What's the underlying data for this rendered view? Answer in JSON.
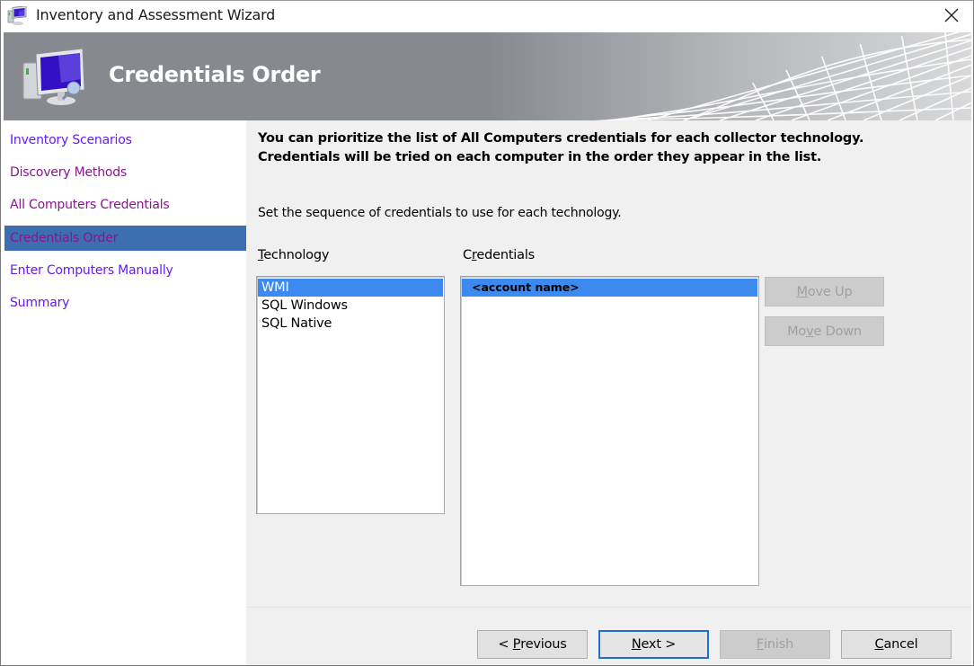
{
  "window": {
    "title": "Inventory and Assessment Wizard",
    "app_icon": "computer-icon",
    "close_icon": "close-icon"
  },
  "banner": {
    "title": "Credentials Order",
    "icon": "monitor-computer-icon"
  },
  "sidebar": {
    "items": [
      {
        "label": "Inventory Scenarios",
        "state": "link"
      },
      {
        "label": "Discovery Methods",
        "state": "visited"
      },
      {
        "label": "All Computers Credentials",
        "state": "visited"
      },
      {
        "label": "Credentials Order",
        "state": "selected"
      },
      {
        "label": "Enter Computers Manually",
        "state": "link"
      },
      {
        "label": "Summary",
        "state": "link"
      }
    ]
  },
  "content": {
    "intro": "You can prioritize the list of All Computers credentials for each collector technology. Credentials will be tried on each computer in the order they appear in the list.",
    "subtext": "Set the sequence of credentials to use for each technology.",
    "technology": {
      "label_mnemonic": "T",
      "label_rest": "echnology",
      "items": [
        "WMI",
        "SQL Windows",
        "SQL Native"
      ],
      "selected": "WMI"
    },
    "credentials": {
      "label_pre": "C",
      "label_mnemonic": "r",
      "label_rest": "edentials",
      "items": [
        "<account name>"
      ],
      "selected": "<account name>"
    },
    "move_up": {
      "pre": "",
      "mnemonic": "M",
      "rest": "ove Up",
      "enabled": false
    },
    "move_down": {
      "pre": "Mo",
      "mnemonic": "v",
      "rest": "e Down",
      "enabled": false
    }
  },
  "footer": {
    "previous": {
      "pre": "< ",
      "mnemonic": "P",
      "rest": "revious",
      "enabled": true
    },
    "next": {
      "pre": "",
      "mnemonic": "N",
      "rest": "ext >",
      "enabled": true,
      "default": true
    },
    "finish": {
      "pre": "",
      "mnemonic": "F",
      "rest": "inish",
      "enabled": false
    },
    "cancel": {
      "pre": "",
      "mnemonic": "C",
      "rest": "ancel",
      "enabled": true
    }
  },
  "colors": {
    "nav_link": "#6618ff",
    "nav_visited": "#8a1490",
    "nav_selected_bg": "#3c6eb0",
    "list_selection": "#3c8af0",
    "default_button_border": "#1e6fd0"
  }
}
